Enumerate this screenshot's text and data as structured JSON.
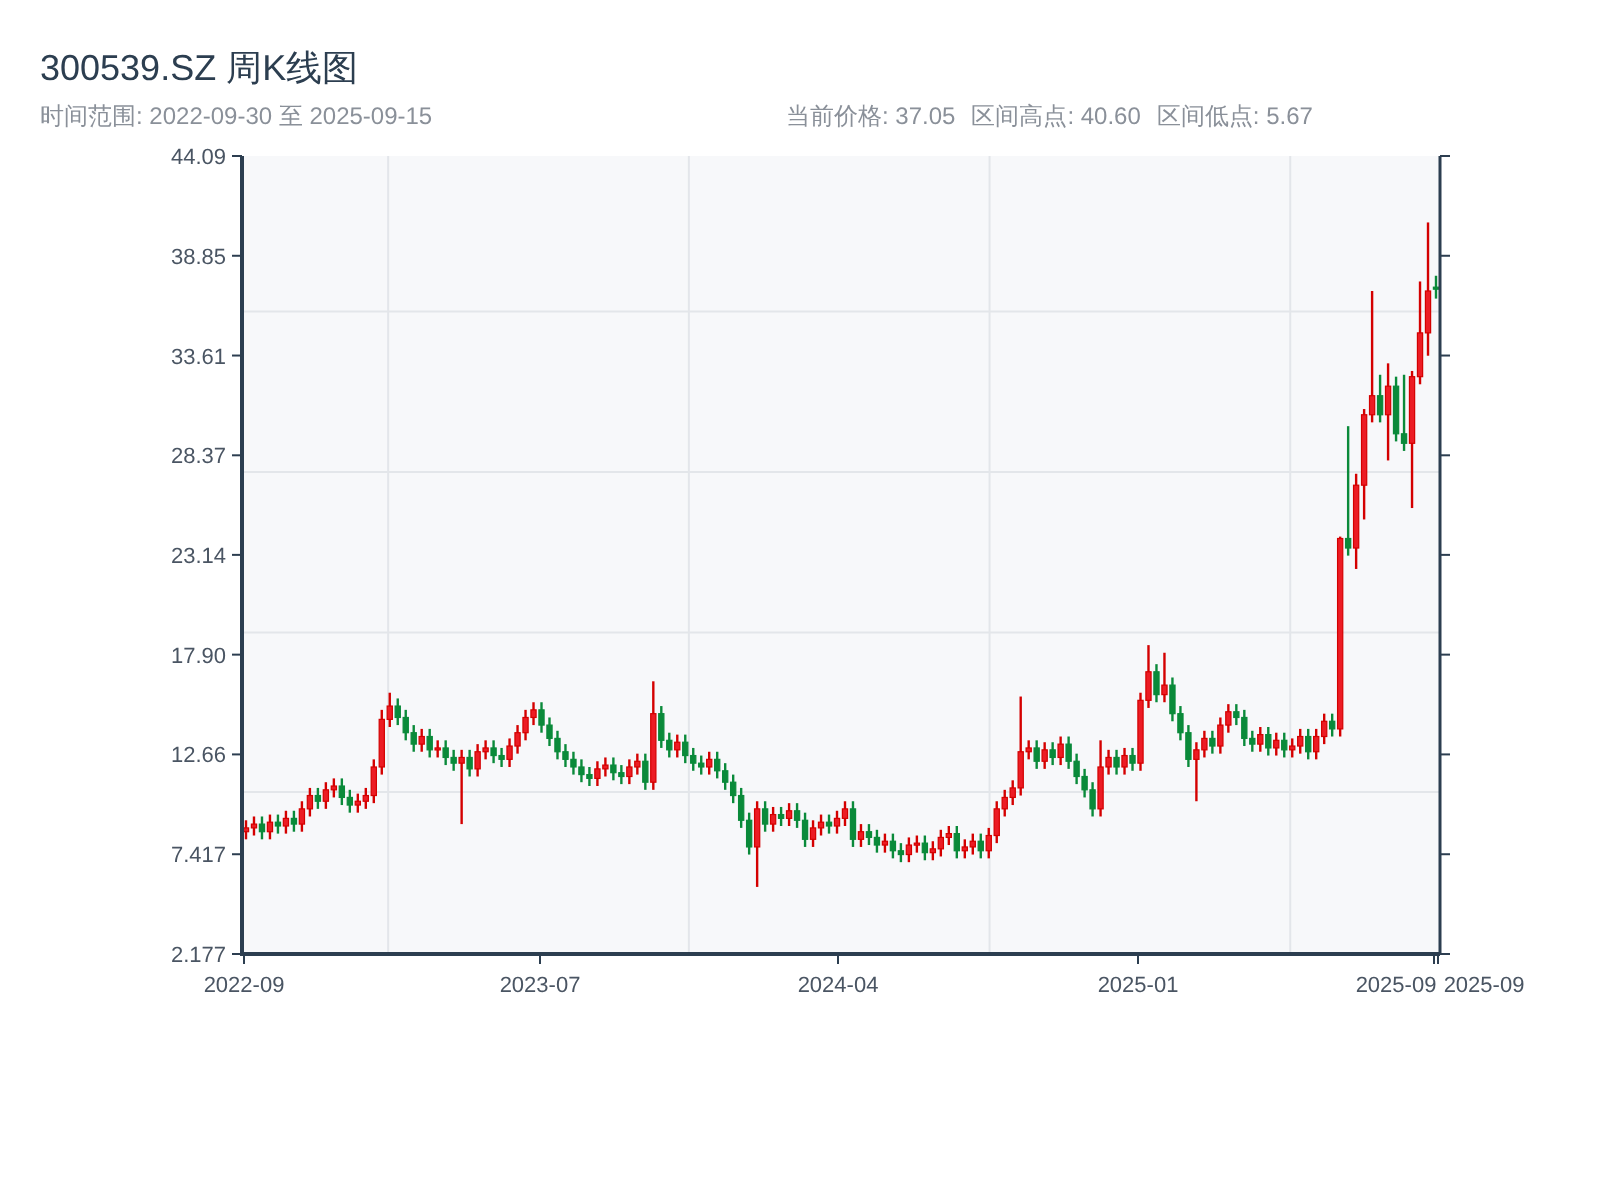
{
  "title": "300539.SZ 周K线图",
  "range_text": "时间范围: 2022-09-30 至 2025-09-15",
  "stats": [
    "当前价格: 37.05",
    "区间高点: 40.60",
    "区间低点: 5.67"
  ],
  "x_axis_labels": [
    "2022-09",
    "2023-07",
    "2024-04",
    "2025-01",
    "2025-09",
    "2025-09"
  ],
  "chart_data": {
    "type": "candlestick",
    "ylim": [
      2.177,
      44.09
    ],
    "yticks": [
      {
        "value": 2.177,
        "label": "2.177"
      },
      {
        "value": 7.417,
        "label": "7.417"
      },
      {
        "value": 12.66,
        "label": "12.66"
      },
      {
        "value": 17.9,
        "label": "17.90"
      },
      {
        "value": 23.14,
        "label": "23.14"
      },
      {
        "value": 28.37,
        "label": "28.37"
      },
      {
        "value": 33.61,
        "label": "33.61"
      },
      {
        "value": 38.85,
        "label": "38.85"
      },
      {
        "value": 44.09,
        "label": "44.09"
      }
    ],
    "ohlc": [
      [
        8.6,
        9.2,
        8.2,
        8.8
      ],
      [
        8.8,
        9.4,
        8.4,
        9.0
      ],
      [
        9.0,
        9.4,
        8.2,
        8.6
      ],
      [
        8.6,
        9.5,
        8.2,
        9.1
      ],
      [
        9.1,
        9.5,
        8.5,
        8.9
      ],
      [
        8.9,
        9.7,
        8.5,
        9.3
      ],
      [
        9.3,
        9.7,
        8.6,
        9.0
      ],
      [
        9.0,
        10.2,
        8.6,
        9.8
      ],
      [
        9.8,
        10.9,
        9.4,
        10.5
      ],
      [
        10.5,
        10.9,
        9.8,
        10.2
      ],
      [
        10.2,
        11.2,
        9.8,
        10.8
      ],
      [
        10.8,
        11.4,
        10.4,
        11.0
      ],
      [
        11.0,
        11.4,
        10.0,
        10.4
      ],
      [
        10.4,
        10.8,
        9.6,
        10.0
      ],
      [
        10.0,
        10.6,
        9.6,
        10.2
      ],
      [
        10.2,
        10.9,
        9.8,
        10.5
      ],
      [
        10.5,
        12.4,
        10.1,
        12.0
      ],
      [
        12.0,
        15.0,
        11.6,
        14.5
      ],
      [
        14.5,
        15.9,
        14.1,
        15.2
      ],
      [
        15.2,
        15.6,
        14.2,
        14.6
      ],
      [
        14.6,
        15.0,
        13.4,
        13.8
      ],
      [
        13.8,
        14.2,
        12.8,
        13.2
      ],
      [
        13.2,
        14.0,
        12.8,
        13.6
      ],
      [
        13.6,
        14.0,
        12.5,
        12.9
      ],
      [
        12.9,
        13.4,
        12.5,
        13.0
      ],
      [
        13.0,
        13.4,
        12.1,
        12.5
      ],
      [
        12.5,
        12.9,
        11.8,
        12.2
      ],
      [
        12.2,
        12.9,
        9.0,
        12.5
      ],
      [
        12.5,
        12.9,
        11.5,
        11.9
      ],
      [
        11.9,
        13.2,
        11.5,
        12.8
      ],
      [
        12.8,
        13.4,
        12.4,
        13.0
      ],
      [
        13.0,
        13.4,
        12.2,
        12.6
      ],
      [
        12.6,
        13.0,
        12.0,
        12.4
      ],
      [
        12.4,
        13.5,
        12.0,
        13.1
      ],
      [
        13.1,
        14.2,
        12.7,
        13.8
      ],
      [
        13.8,
        15.0,
        13.4,
        14.6
      ],
      [
        14.6,
        15.4,
        14.2,
        15.0
      ],
      [
        15.0,
        15.4,
        13.8,
        14.2
      ],
      [
        14.2,
        14.6,
        13.1,
        13.5
      ],
      [
        13.5,
        13.9,
        12.4,
        12.8
      ],
      [
        12.8,
        13.2,
        12.0,
        12.4
      ],
      [
        12.4,
        12.8,
        11.6,
        12.0
      ],
      [
        12.0,
        12.4,
        11.2,
        11.6
      ],
      [
        11.6,
        12.0,
        11.0,
        11.4
      ],
      [
        11.4,
        12.3,
        11.0,
        11.9
      ],
      [
        11.9,
        12.5,
        11.5,
        12.1
      ],
      [
        12.1,
        12.5,
        11.3,
        11.7
      ],
      [
        11.7,
        12.1,
        11.1,
        11.5
      ],
      [
        11.5,
        12.4,
        11.1,
        12.0
      ],
      [
        12.0,
        12.7,
        11.6,
        12.3
      ],
      [
        12.3,
        12.7,
        10.8,
        11.2
      ],
      [
        11.2,
        16.5,
        10.8,
        14.8
      ],
      [
        14.8,
        15.2,
        13.0,
        13.4
      ],
      [
        13.4,
        13.8,
        12.5,
        12.9
      ],
      [
        12.9,
        13.7,
        12.5,
        13.3
      ],
      [
        13.3,
        13.7,
        12.2,
        12.6
      ],
      [
        12.6,
        13.0,
        11.8,
        12.2
      ],
      [
        12.2,
        12.6,
        11.6,
        12.0
      ],
      [
        12.0,
        12.8,
        11.6,
        12.4
      ],
      [
        12.4,
        12.8,
        11.4,
        11.8
      ],
      [
        11.8,
        12.2,
        10.8,
        11.2
      ],
      [
        11.2,
        11.6,
        10.1,
        10.5
      ],
      [
        10.5,
        10.9,
        8.8,
        9.2
      ],
      [
        9.2,
        9.6,
        7.4,
        7.8
      ],
      [
        7.8,
        10.2,
        5.7,
        9.8
      ],
      [
        9.8,
        10.2,
        8.6,
        9.0
      ],
      [
        9.0,
        9.9,
        8.6,
        9.5
      ],
      [
        9.5,
        9.9,
        8.9,
        9.3
      ],
      [
        9.3,
        10.1,
        8.9,
        9.7
      ],
      [
        9.7,
        10.1,
        8.8,
        9.2
      ],
      [
        9.2,
        9.6,
        7.8,
        8.2
      ],
      [
        8.2,
        9.2,
        7.8,
        8.8
      ],
      [
        8.8,
        9.5,
        8.4,
        9.1
      ],
      [
        9.1,
        9.5,
        8.5,
        8.9
      ],
      [
        8.9,
        9.7,
        8.5,
        9.3
      ],
      [
        9.3,
        10.2,
        8.9,
        9.8
      ],
      [
        9.8,
        10.2,
        7.8,
        8.2
      ],
      [
        8.2,
        9.0,
        7.8,
        8.6
      ],
      [
        8.6,
        9.0,
        7.9,
        8.3
      ],
      [
        8.3,
        8.7,
        7.5,
        7.9
      ],
      [
        7.9,
        8.5,
        7.5,
        8.1
      ],
      [
        8.1,
        8.5,
        7.2,
        7.6
      ],
      [
        7.6,
        8.0,
        7.0,
        7.4
      ],
      [
        7.4,
        8.3,
        7.0,
        7.9
      ],
      [
        7.9,
        8.4,
        7.5,
        8.0
      ],
      [
        8.0,
        8.4,
        7.1,
        7.5
      ],
      [
        7.5,
        8.1,
        7.1,
        7.7
      ],
      [
        7.7,
        8.7,
        7.3,
        8.3
      ],
      [
        8.3,
        8.9,
        7.9,
        8.5
      ],
      [
        8.5,
        8.9,
        7.2,
        7.6
      ],
      [
        7.6,
        8.2,
        7.2,
        7.8
      ],
      [
        7.8,
        8.5,
        7.4,
        8.1
      ],
      [
        8.1,
        8.5,
        7.2,
        7.6
      ],
      [
        7.6,
        8.8,
        7.2,
        8.4
      ],
      [
        8.4,
        10.2,
        8.0,
        9.8
      ],
      [
        9.8,
        10.8,
        9.4,
        10.4
      ],
      [
        10.4,
        11.3,
        10.0,
        10.9
      ],
      [
        10.9,
        15.7,
        10.5,
        12.8
      ],
      [
        12.8,
        13.4,
        12.4,
        13.0
      ],
      [
        13.0,
        13.4,
        11.9,
        12.3
      ],
      [
        12.3,
        13.3,
        11.9,
        12.9
      ],
      [
        12.9,
        13.3,
        12.1,
        12.5
      ],
      [
        12.5,
        13.6,
        12.1,
        13.2
      ],
      [
        13.2,
        13.6,
        11.9,
        12.3
      ],
      [
        12.3,
        12.7,
        11.1,
        11.5
      ],
      [
        11.5,
        11.9,
        10.4,
        10.8
      ],
      [
        10.8,
        11.2,
        9.4,
        9.8
      ],
      [
        9.8,
        13.4,
        9.4,
        12.0
      ],
      [
        12.0,
        12.9,
        11.6,
        12.5
      ],
      [
        12.5,
        12.9,
        11.6,
        12.0
      ],
      [
        12.0,
        13.0,
        11.6,
        12.6
      ],
      [
        12.6,
        13.0,
        11.8,
        12.2
      ],
      [
        12.2,
        15.9,
        11.8,
        15.5
      ],
      [
        15.5,
        18.4,
        15.1,
        17.0
      ],
      [
        17.0,
        17.4,
        15.4,
        15.8
      ],
      [
        15.8,
        18.0,
        15.4,
        16.3
      ],
      [
        16.3,
        16.7,
        14.4,
        14.8
      ],
      [
        14.8,
        15.2,
        13.4,
        13.8
      ],
      [
        13.8,
        14.2,
        12.0,
        12.4
      ],
      [
        12.4,
        13.3,
        10.2,
        12.9
      ],
      [
        12.9,
        13.9,
        12.5,
        13.5
      ],
      [
        13.5,
        13.9,
        12.7,
        13.1
      ],
      [
        13.1,
        14.6,
        12.7,
        14.2
      ],
      [
        14.2,
        15.3,
        13.8,
        14.9
      ],
      [
        14.9,
        15.3,
        14.2,
        14.6
      ],
      [
        14.6,
        15.0,
        13.1,
        13.5
      ],
      [
        13.5,
        13.9,
        12.8,
        13.2
      ],
      [
        13.2,
        14.1,
        12.8,
        13.7
      ],
      [
        13.7,
        14.1,
        12.6,
        13.0
      ],
      [
        13.0,
        13.8,
        12.6,
        13.4
      ],
      [
        13.4,
        13.8,
        12.5,
        12.9
      ],
      [
        12.9,
        13.5,
        12.5,
        13.1
      ],
      [
        13.1,
        14.0,
        12.7,
        13.6
      ],
      [
        13.6,
        14.0,
        12.4,
        12.8
      ],
      [
        12.8,
        14.0,
        12.4,
        13.6
      ],
      [
        13.6,
        14.8,
        13.2,
        14.4
      ],
      [
        14.4,
        14.8,
        13.6,
        14.0
      ],
      [
        14.0,
        24.1,
        13.6,
        24.0
      ],
      [
        24.0,
        29.9,
        23.1,
        23.5
      ],
      [
        23.5,
        27.4,
        22.4,
        26.8
      ],
      [
        26.8,
        30.8,
        25.0,
        30.5
      ],
      [
        30.5,
        37.0,
        30.1,
        31.5
      ],
      [
        31.5,
        32.6,
        30.1,
        30.5
      ],
      [
        30.5,
        33.2,
        28.1,
        32.0
      ],
      [
        32.0,
        32.5,
        29.1,
        29.5
      ],
      [
        29.5,
        32.6,
        28.6,
        29.0
      ],
      [
        29.0,
        32.8,
        25.6,
        32.5
      ],
      [
        32.5,
        37.5,
        32.1,
        34.8
      ],
      [
        34.8,
        40.6,
        33.6,
        37.0
      ],
      [
        37.2,
        37.8,
        36.6,
        37.1
      ]
    ]
  }
}
